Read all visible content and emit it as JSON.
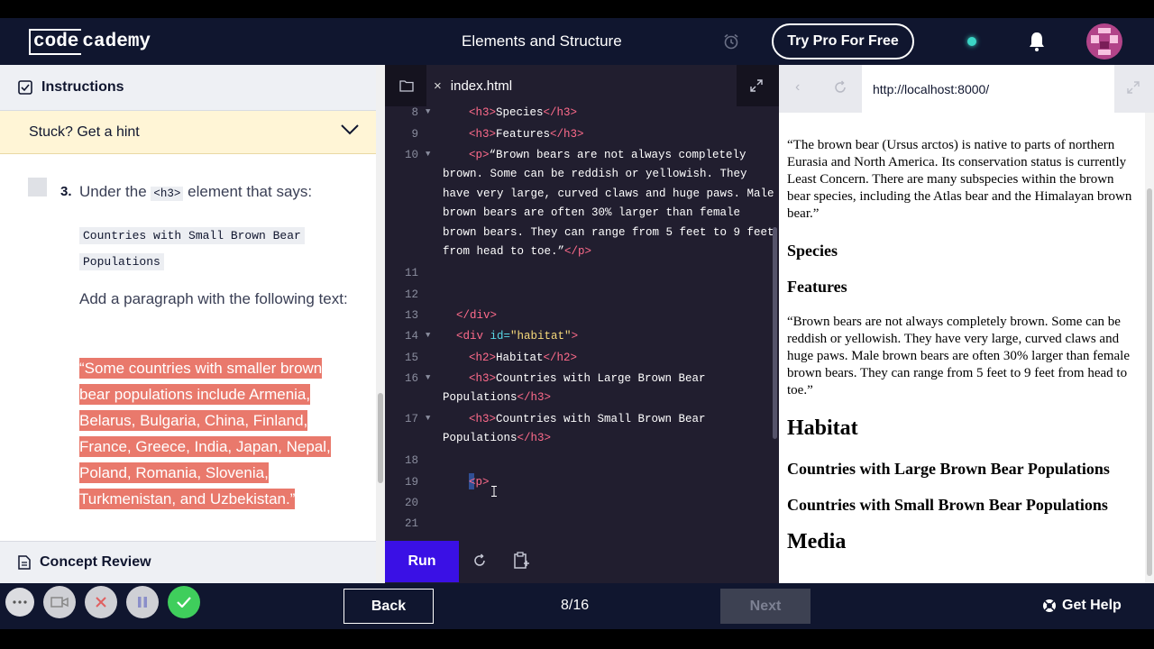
{
  "header": {
    "logo_box": "code",
    "logo_rest": "cademy",
    "title": "Elements and Structure",
    "pro_button": "Try Pro For Free"
  },
  "instructions": {
    "heading": "Instructions",
    "hint": "Stuck? Get a hint",
    "task_number": "3.",
    "task_text_pre": "Under the",
    "task_tag": "<h3>",
    "task_text_post": "element that says:",
    "code_line_1": "Countries with Small Brown Bear",
    "code_line_2": "Populations",
    "para": "Add a paragraph with the following text:",
    "highlight": "“Some countries with smaller brown bear populations include Armenia, Belarus, Bulgaria, China, Finland, France, Greece, India, Japan, Nepal, Poland, Romania, Slovenia, Turkmenistan, and Uzbekistan.”",
    "concept_review": "Concept Review"
  },
  "editor": {
    "tab_close": "×",
    "tab_name": "index.html",
    "line_numbers": [
      "8",
      "9",
      "10",
      "11",
      "12",
      "13",
      "14",
      "15",
      "16",
      "17",
      "18",
      "19",
      "20",
      "21"
    ],
    "lines": {
      "l8_tag_open": "<h3>",
      "l8_text": "Species",
      "l8_tag_close": "</h3>",
      "l9_tag_open": "<h3>",
      "l9_text": "Features",
      "l9_tag_close": "</h3>",
      "l10_tag_open": "<p>",
      "l10_w1": "“Brown bears are not always completely",
      "l10_w2": "brown. Some can be reddish or yellowish. They",
      "l10_w3": "have very large, curved claws and huge paws. Male",
      "l10_w4": "brown bears are often 30% larger than female",
      "l10_w5": "brown bears. They can range from 5 feet to 9 feet",
      "l10_w6": "from head to toe.”",
      "l10_tag_close": "</p>",
      "l13": "</div>",
      "l14_open": "<div",
      "l14_attr": "id=",
      "l14_val": "\"habitat\"",
      "l14_close": ">",
      "l15_tag_open": "<h2>",
      "l15_text": "Habitat",
      "l15_tag_close": "</h2>",
      "l16_tag_open": "<h3>",
      "l16_text": "Countries with Large Brown Bear",
      "l16_w2": "Populations",
      "l16_tag_close": "</h3>",
      "l17_tag_open": "<h3>",
      "l17_text": "Countries with Small Brown Bear",
      "l17_w2": "Populations",
      "l17_tag_close": "</h3>",
      "l19": "<p>"
    },
    "run_button": "Run"
  },
  "browser": {
    "url": "http://localhost:8000/",
    "intro": "“The brown bear (Ursus arctos) is native to parts of northern Eurasia and North America. Its conservation status is currently Least Concern. There are many subspecies within the brown bear species, including the Atlas bear and the Himalayan brown bear.”",
    "species": "Species",
    "features": "Features",
    "features_text": "“Brown bears are not always completely brown. Some can be reddish or yellowish. They have very large, curved claws and huge paws. Male brown bears are often 30% larger than female brown bears. They can range from 5 feet to 9 feet from head to toe.”",
    "habitat": "Habitat",
    "large": "Countries with Large Brown Bear Populations",
    "small": "Countries with Small Brown Bear Populations",
    "media": "Media"
  },
  "footer": {
    "back": "Back",
    "progress": "8/16",
    "next": "Next",
    "help": "Get Help"
  },
  "colors": {
    "navy": "#10162f",
    "accent": "#3a10e5",
    "highlight": "#e9796c",
    "hint_bg": "#fff5d6"
  }
}
